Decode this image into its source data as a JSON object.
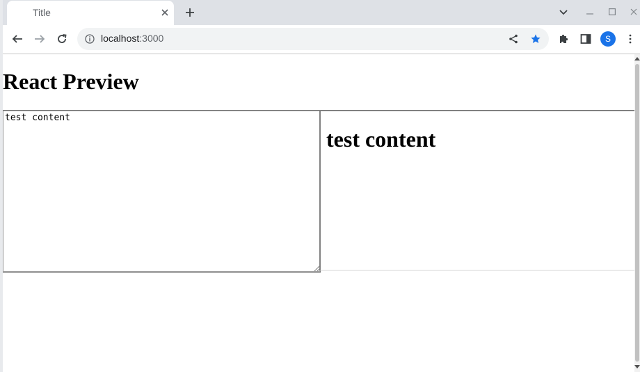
{
  "browser": {
    "tab_title": "Title",
    "url_host": "localhost",
    "url_port": ":3000",
    "profile_initial": "S"
  },
  "page": {
    "title": "React Preview",
    "editor_value": "test content",
    "preview_heading": "test content"
  },
  "colors": {
    "tabstrip": "#dee1e6",
    "omnibox": "#f1f3f4",
    "bookmark_star": "#1a73e8",
    "avatar": "#1a73e8"
  }
}
